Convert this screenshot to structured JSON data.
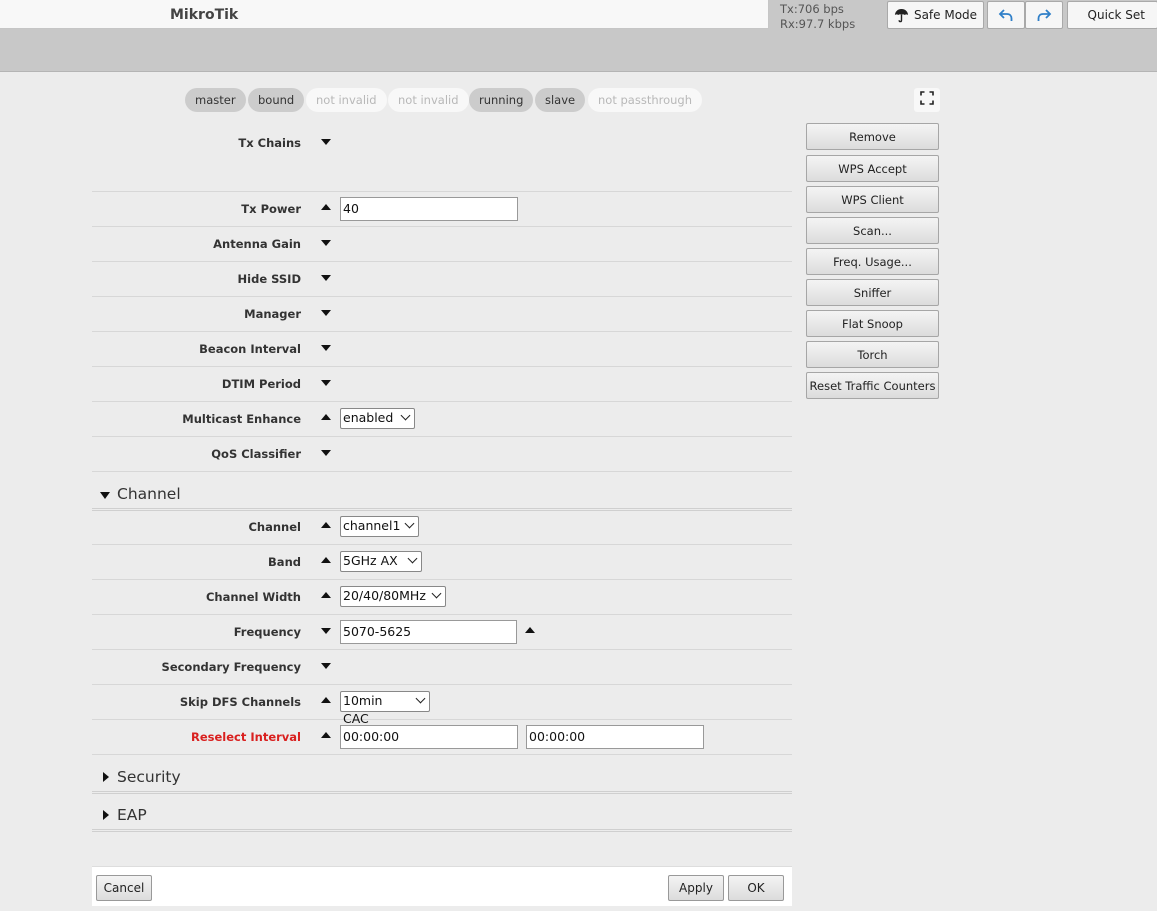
{
  "header": {
    "title": "MikroTik",
    "tx": "Tx:706 bps",
    "rx": "Rx:97.7 kbps",
    "safe_mode_label": "Safe Mode",
    "quick_set_label": "Quick Set"
  },
  "flags": [
    {
      "label": "master",
      "active": true
    },
    {
      "label": "bound",
      "active": true
    },
    {
      "label": "not invalid",
      "active": false
    },
    {
      "label": "not invalid",
      "active": false
    },
    {
      "label": "running",
      "active": true
    },
    {
      "label": "slave",
      "active": true
    },
    {
      "label": "not passthrough",
      "active": false
    }
  ],
  "fields": {
    "tx_chains": {
      "label": "Tx Chains"
    },
    "tx_power": {
      "label": "Tx Power",
      "value": "40"
    },
    "antenna_gain": {
      "label": "Antenna Gain"
    },
    "hide_ssid": {
      "label": "Hide SSID"
    },
    "manager": {
      "label": "Manager"
    },
    "beacon_interval": {
      "label": "Beacon Interval"
    },
    "dtim_period": {
      "label": "DTIM Period"
    },
    "multicast_enhance": {
      "label": "Multicast Enhance",
      "value": "enabled"
    },
    "qos_classifier": {
      "label": "QoS Classifier"
    }
  },
  "channel_section": {
    "title": "Channel",
    "channel": {
      "label": "Channel",
      "value": "channel1"
    },
    "band": {
      "label": "Band",
      "value": "5GHz AX"
    },
    "channel_width": {
      "label": "Channel Width",
      "value": "20/40/80MHz"
    },
    "frequency": {
      "label": "Frequency",
      "value": "5070-5625"
    },
    "secondary_frequency": {
      "label": "Secondary Frequency"
    },
    "skip_dfs_channels": {
      "label": "Skip DFS Channels",
      "value": "10min CAC"
    },
    "reselect_interval": {
      "label": "Reselect Interval",
      "value_from": "00:00:00",
      "value_to": "00:00:00"
    }
  },
  "collapsed_sections": {
    "security": "Security",
    "eap": "EAP"
  },
  "side_buttons": {
    "remove": "Remove",
    "wps_accept": "WPS Accept",
    "wps_client": "WPS Client",
    "scan": "Scan...",
    "freq_usage": "Freq. Usage...",
    "sniffer": "Sniffer",
    "flat_snoop": "Flat Snoop",
    "torch": "Torch",
    "reset_traffic_counters": "Reset Traffic Counters"
  },
  "bottom": {
    "cancel": "Cancel",
    "apply": "Apply",
    "ok": "OK"
  },
  "colors": {
    "alert_label": "#d9201f",
    "undo_redo_icon": "#2f7fc8"
  },
  "icons": {
    "safe_mode": "umbrella-icon",
    "undo": "undo-icon",
    "redo": "redo-icon",
    "fullscreen": "fullscreen-icon"
  }
}
